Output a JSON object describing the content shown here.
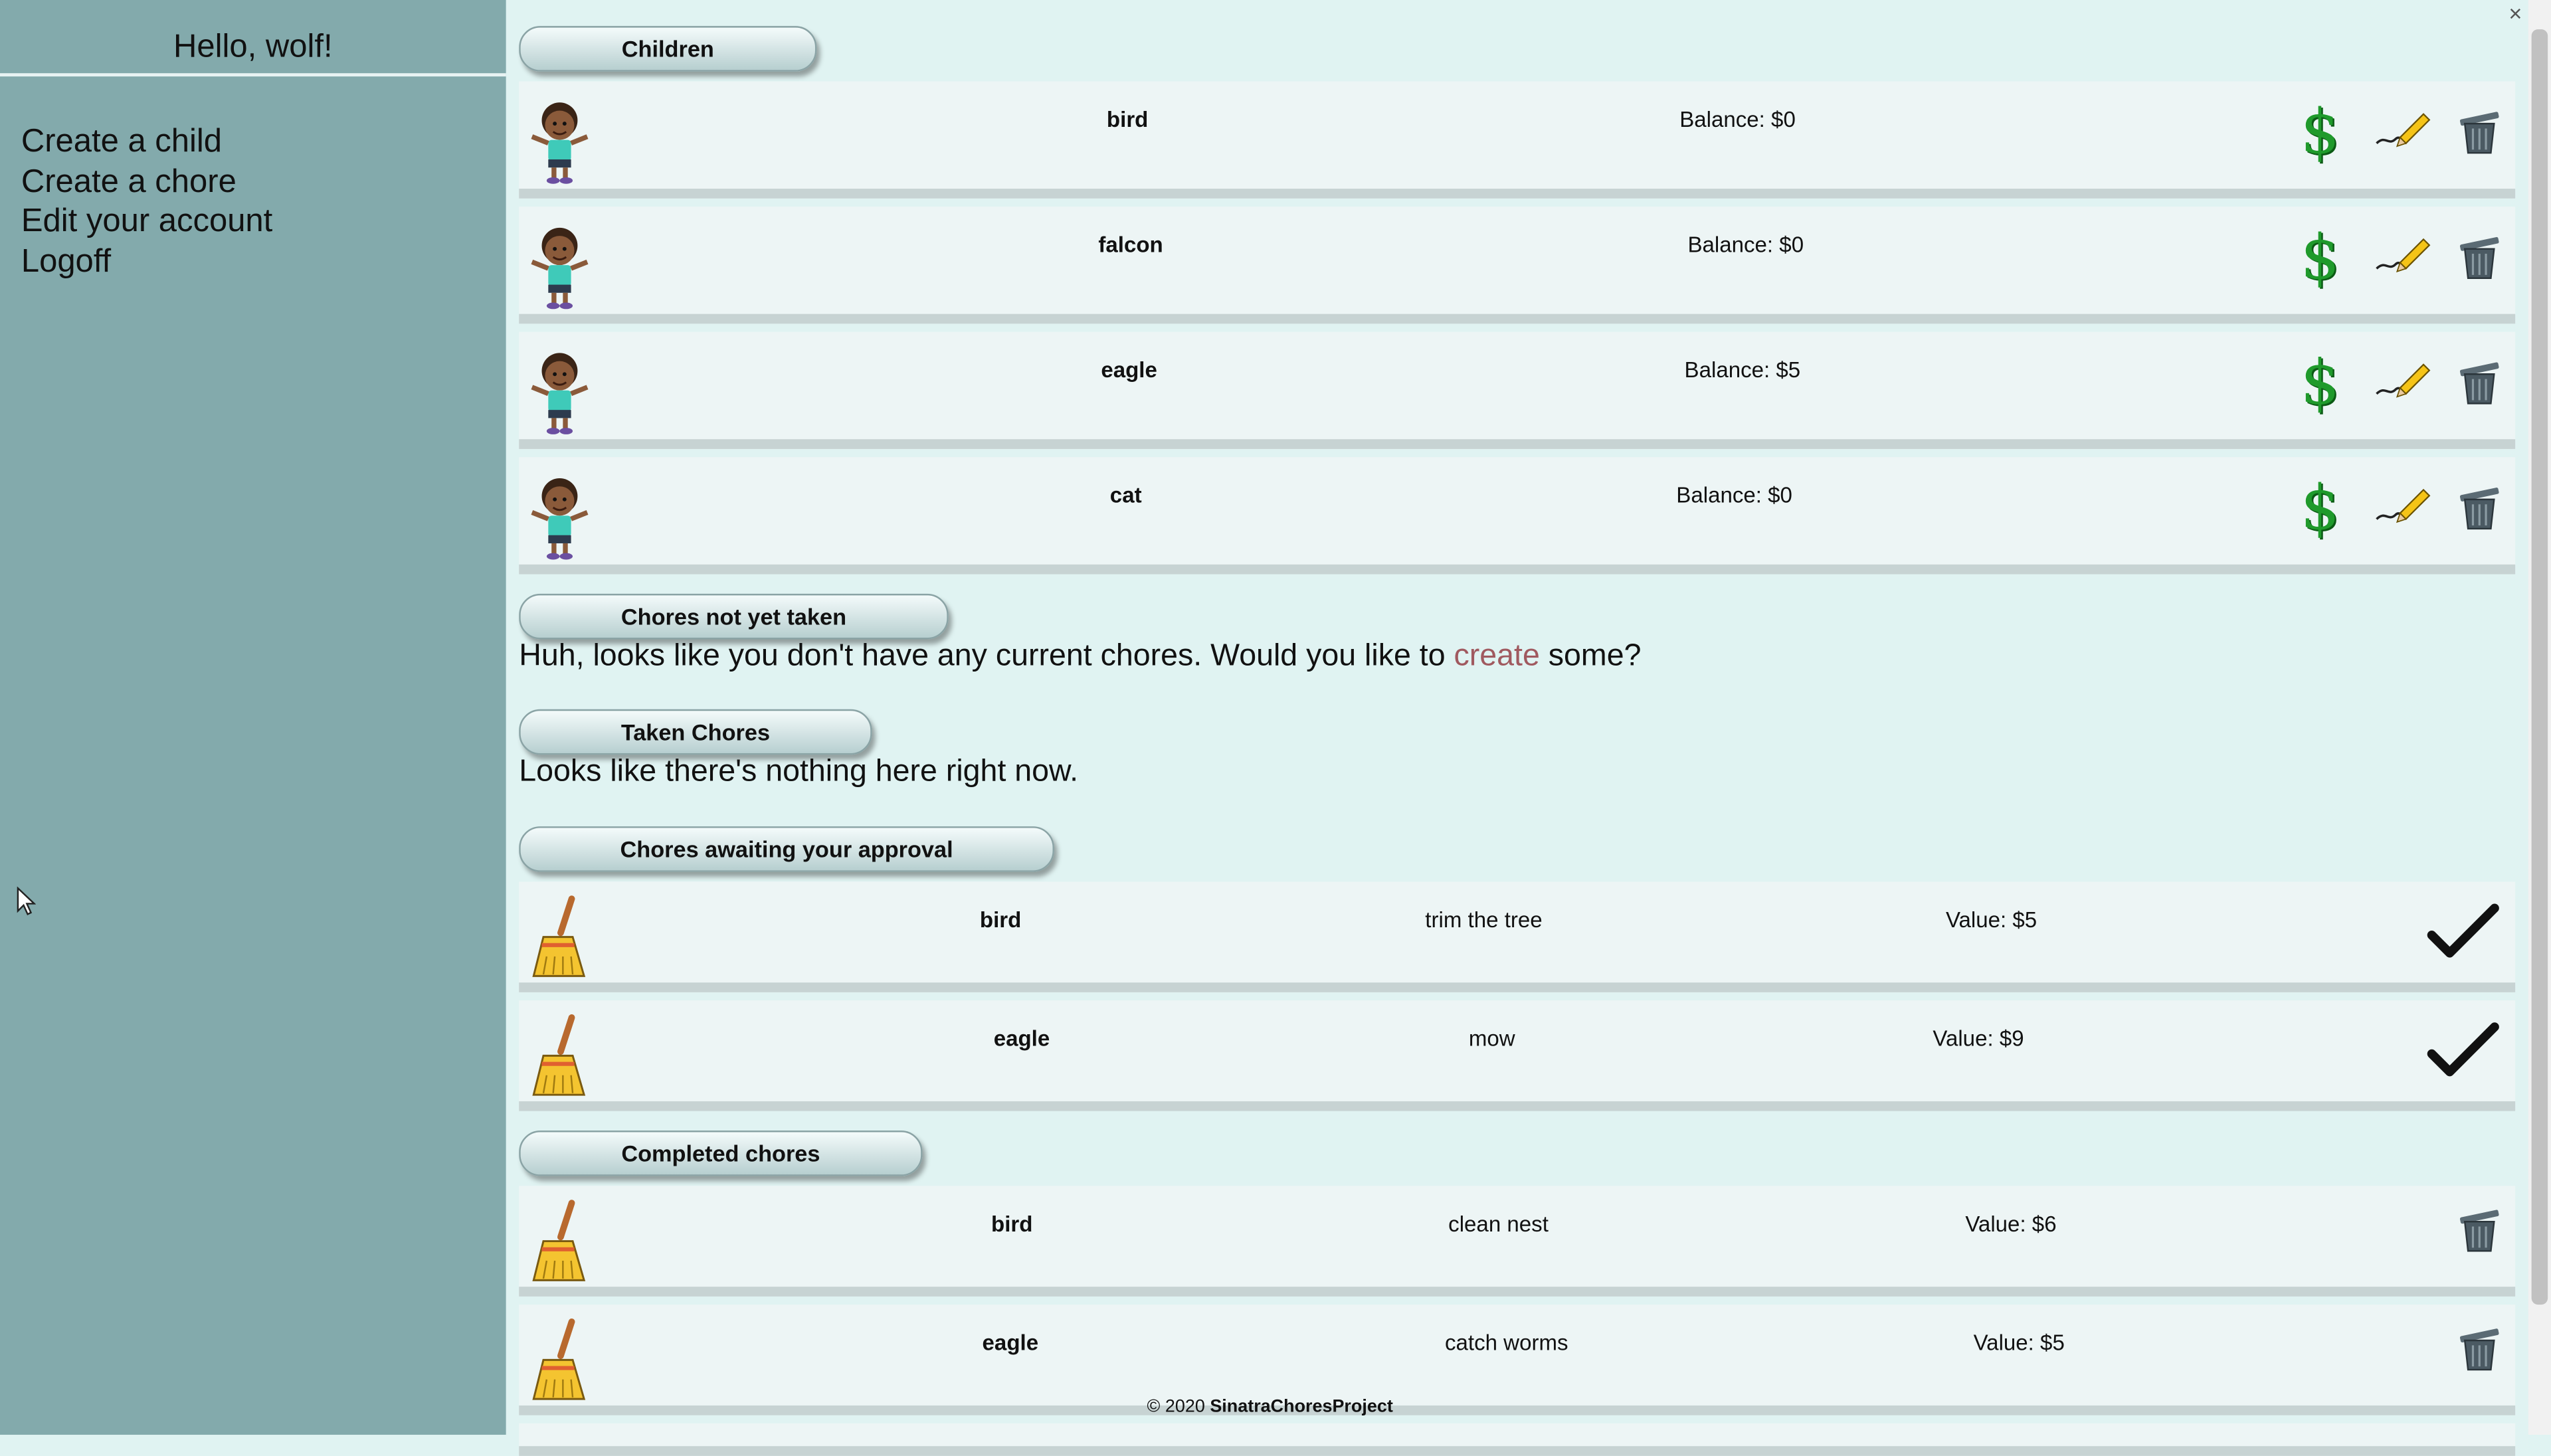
{
  "window": {
    "close_glyph": "×"
  },
  "sidebar": {
    "greeting": "Hello, wolf!",
    "menu": [
      "Create a child",
      "Create a chore",
      "Edit your account",
      "Logoff"
    ]
  },
  "sections": {
    "children": "Children",
    "not_taken": "Chores not yet taken",
    "taken": "Taken Chores",
    "awaiting": "Chores awaiting your approval",
    "completed": "Completed chores"
  },
  "messages": {
    "no_chores_prefix": "Huh, looks like you don't have any current chores. Would you like to ",
    "no_chores_link": "create",
    "no_chores_suffix": " some?",
    "nothing_taken": "Looks like there's nothing here right now."
  },
  "children": [
    {
      "name": "bird",
      "balance": "Balance: $0"
    },
    {
      "name": "falcon",
      "balance": "Balance: $0"
    },
    {
      "name": "eagle",
      "balance": "Balance: $5"
    },
    {
      "name": "cat",
      "balance": "Balance: $0"
    }
  ],
  "awaiting_chores": [
    {
      "child": "bird",
      "chore": "trim the tree",
      "value": "Value: $5"
    },
    {
      "child": "eagle",
      "chore": "mow",
      "value": "Value: $9"
    }
  ],
  "completed_chores": [
    {
      "child": "bird",
      "chore": "clean nest",
      "value": "Value: $6"
    },
    {
      "child": "eagle",
      "chore": "catch worms",
      "value": "Value: $5"
    }
  ],
  "icons": {
    "money": "$",
    "avatar": "child-avatar-icon",
    "chore": "broom-icon",
    "edit": "pencil-icon",
    "delete": "trash-can-icon",
    "approve": "check-mark-icon"
  },
  "colors": {
    "sidebar": "#83aaac",
    "content_bg": "#e0f3f2",
    "card": "#edf5f5",
    "link": "#a0595f",
    "money_green": "#1f9a2b"
  },
  "footer": {
    "copyright": "© 2020 ",
    "project": "SinatraChoresProject"
  }
}
